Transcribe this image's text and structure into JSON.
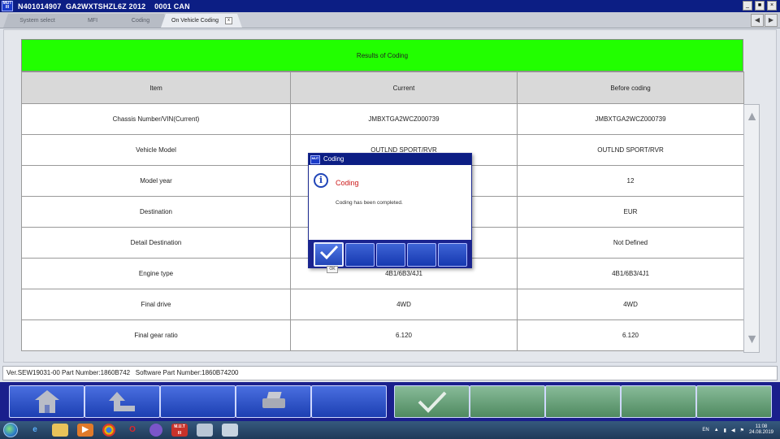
{
  "window": {
    "title": "N401014907  GA2WXTSHZL6Z 2012    0001 CAN",
    "app_icon_text": "M.U.T. III",
    "buttons": [
      "_",
      "■",
      "×"
    ]
  },
  "tabs": [
    {
      "label": "System select",
      "active": false
    },
    {
      "label": "MFI",
      "active": false
    },
    {
      "label": "Coding",
      "active": false
    },
    {
      "label": "On Vehicle Coding",
      "active": true,
      "close": "x"
    }
  ],
  "tab_nav": {
    "prev": "◀",
    "next": "▶"
  },
  "results": {
    "header": "Results of Coding",
    "columns": [
      "Item",
      "Current",
      "Before coding"
    ],
    "rows": [
      {
        "item": "Chassis Number/VIN(Current)",
        "current": "JMBXTGA2WCZ000739",
        "before": "JMBXTGA2WCZ000739"
      },
      {
        "item": "Vehicle Model",
        "current": "OUTLND SPORT/RVR",
        "before": "OUTLND SPORT/RVR"
      },
      {
        "item": "Model year",
        "current": "",
        "before": "12"
      },
      {
        "item": "Destination",
        "current": "",
        "before": "EUR"
      },
      {
        "item": "Detail Destination",
        "current": "",
        "before": "Not Defined"
      },
      {
        "item": "Engine type",
        "current": "4B1/6B3/4J1",
        "before": "4B1/6B3/4J1"
      },
      {
        "item": "Final drive",
        "current": "4WD",
        "before": "4WD"
      },
      {
        "item": "Final gear ratio",
        "current": "6.120",
        "before": "6.120"
      }
    ]
  },
  "status_bar": "Ver.SEW19031-00 Part Number:1860B742   Software Part Number:1860B74200",
  "dialog": {
    "title": "Coding",
    "heading": "Coding",
    "message": "Coding has been completed.",
    "ok_tooltip": "OK"
  },
  "bottom_buttons": [
    {
      "icon": "home-icon",
      "color": "blue"
    },
    {
      "icon": "back-arrow-icon",
      "color": "blue"
    },
    {
      "icon": "",
      "color": "blue"
    },
    {
      "icon": "printer-icon",
      "color": "blue"
    },
    {
      "icon": "",
      "color": "blue"
    },
    {
      "icon": "checkmark-icon",
      "color": "green"
    },
    {
      "icon": "",
      "color": "green"
    },
    {
      "icon": "",
      "color": "green"
    },
    {
      "icon": "",
      "color": "green"
    },
    {
      "icon": "",
      "color": "green"
    }
  ],
  "taskbar": {
    "icons": [
      "start-orb",
      "internet-explorer-icon",
      "file-explorer-icon",
      "media-player-icon",
      "chrome-icon",
      "opera-icon",
      "viber-icon",
      "mut-app-icon",
      "paint-icon",
      "network-app-icon"
    ],
    "language": "EN",
    "time": "11:08",
    "date": "24.08.2019"
  },
  "colors": {
    "title_bar": "#0c1e84",
    "results_header": "#22ff00",
    "bottom_bar": "#1a1f8c",
    "dialog_heading": "#cc1a1a"
  }
}
